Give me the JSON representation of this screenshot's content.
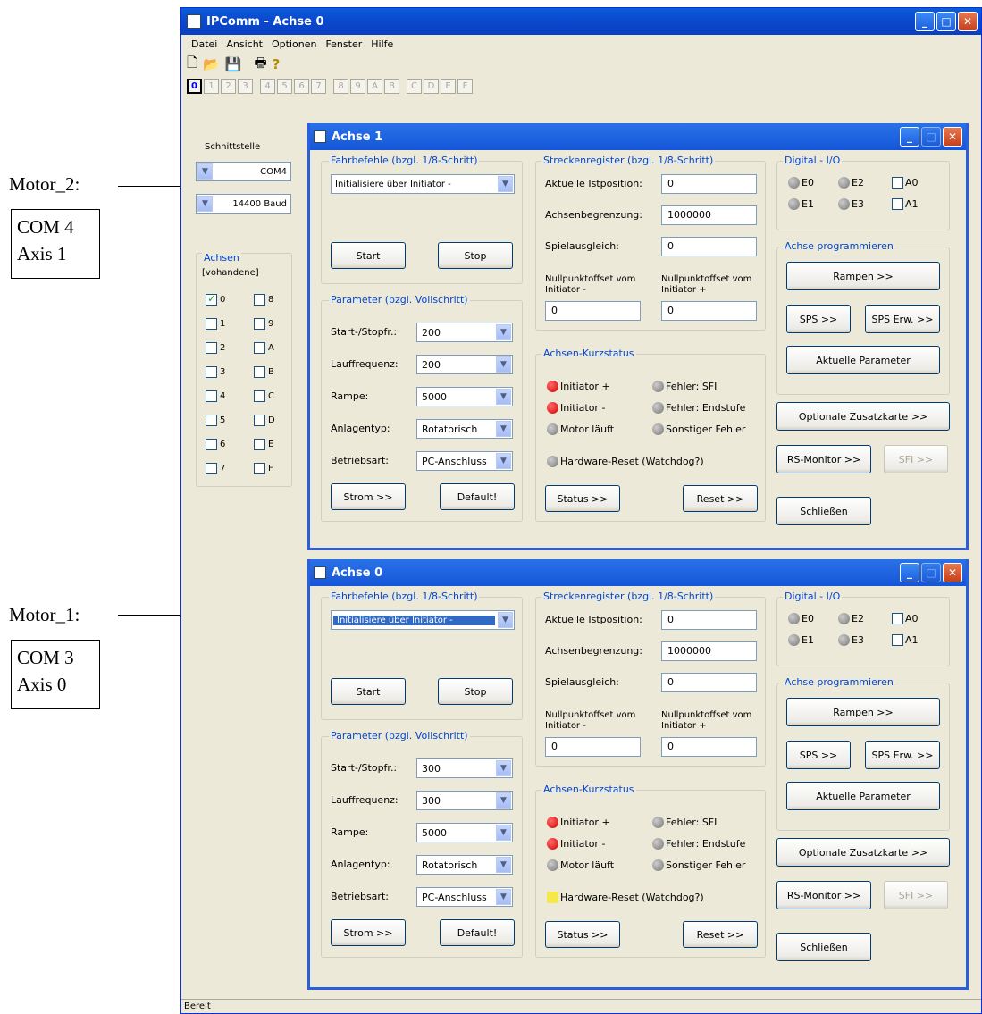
{
  "annotations": [
    {
      "label": "Motor_2:",
      "box": [
        "COM 4",
        "Axis 1"
      ]
    },
    {
      "label": "Motor_1:",
      "box": [
        "COM 3",
        "Axis 0"
      ]
    }
  ],
  "window": {
    "title": "IPComm - Achse 0"
  },
  "menu": [
    "Datei",
    "Ansicht",
    "Optionen",
    "Fenster",
    "Hilfe"
  ],
  "toolbar_icons": [
    "new-icon",
    "open-icon",
    "save-icon",
    "print-icon",
    "help-icon"
  ],
  "axis_tabs": [
    "0",
    "1",
    "2",
    "3",
    "4",
    "5",
    "6",
    "7",
    "8",
    "9",
    "A",
    "B",
    "C",
    "D",
    "E",
    "F"
  ],
  "left": {
    "interface_label": "Schnittstelle",
    "port": "COM4",
    "baud": "14400 Baud",
    "axes_label": "Achsen",
    "axes_sub": "[vohandene]",
    "axes": [
      {
        "l": "0",
        "c": true
      },
      {
        "l": "8",
        "c": false
      },
      {
        "l": "1",
        "c": false
      },
      {
        "l": "9",
        "c": false
      },
      {
        "l": "2",
        "c": false
      },
      {
        "l": "A",
        "c": false
      },
      {
        "l": "3",
        "c": false
      },
      {
        "l": "B",
        "c": false
      },
      {
        "l": "4",
        "c": false
      },
      {
        "l": "C",
        "c": false
      },
      {
        "l": "5",
        "c": false
      },
      {
        "l": "D",
        "c": false
      },
      {
        "l": "6",
        "c": false
      },
      {
        "l": "E",
        "c": false
      },
      {
        "l": "7",
        "c": false
      },
      {
        "l": "F",
        "c": false
      }
    ]
  },
  "child_windows": [
    {
      "title": "Achse 1",
      "drive_group": "Fahrbefehle (bzgl. 1/8-Schritt)",
      "drive_select": "Initialisiere über Initiator -",
      "start": "Start",
      "stop": "Stop",
      "param_group": "Parameter (bzgl. Vollschritt)",
      "params": [
        {
          "label": "Start-/Stopfr.:",
          "value": "200"
        },
        {
          "label": "Lauffrequenz:",
          "value": "200"
        },
        {
          "label": "Rampe:",
          "value": "5000"
        },
        {
          "label": "Anlagentyp:",
          "value": "Rotatorisch"
        },
        {
          "label": "Betriebsart:",
          "value": "PC-Anschluss"
        }
      ],
      "strom": "Strom >>",
      "default": "Default!",
      "reg_group": "Streckenregister (bzgl. 1/8-Schritt)",
      "regs": [
        {
          "label": "Aktuelle Istposition:",
          "value": "0"
        },
        {
          "label": "Achsenbegrenzung:",
          "value": "1000000"
        },
        {
          "label": "Spielausgleich:",
          "value": "0"
        }
      ],
      "offset_minus_label": "Nullpunktoffset vom Initiator -",
      "offset_plus_label": "Nullpunktoffset vom Initiator +",
      "offset_minus": "0",
      "offset_plus": "0",
      "status_group": "Achsen-Kurzstatus",
      "status_left": [
        {
          "label": "Initiator +",
          "color": "red"
        },
        {
          "label": "Initiator -",
          "color": "red"
        },
        {
          "label": "Motor läuft",
          "color": "grey"
        }
      ],
      "status_right": [
        {
          "label": "Fehler: SFI",
          "color": "grey"
        },
        {
          "label": "Fehler: Endstufe",
          "color": "grey"
        },
        {
          "label": "Sonstiger Fehler",
          "color": "grey"
        }
      ],
      "watchdog": {
        "label": "Hardware-Reset (Watchdog?)",
        "color": "grey"
      },
      "status_btn": "Status >>",
      "reset_btn": "Reset >>",
      "io_group": "Digital - I/O",
      "io": {
        "e0": "E0",
        "e1": "E1",
        "e2": "E2",
        "e3": "E3",
        "a0": "A0",
        "a1": "A1"
      },
      "prog_group": "Achse programmieren",
      "rampen": "Rampen >>",
      "sps": "SPS >>",
      "sps_erw": "SPS Erw. >>",
      "aktuelle": "Aktuelle Parameter",
      "optional": "Optionale Zusatzkarte >>",
      "rs_monitor": "RS-Monitor >>",
      "sfi": "SFI >>",
      "close": "Schließen"
    },
    {
      "title": "Achse 0",
      "drive_group": "Fahrbefehle (bzgl. 1/8-Schritt)",
      "drive_select": "Initialisiere über Initiator -",
      "start": "Start",
      "stop": "Stop",
      "param_group": "Parameter (bzgl. Vollschritt)",
      "params": [
        {
          "label": "Start-/Stopfr.:",
          "value": "300"
        },
        {
          "label": "Lauffrequenz:",
          "value": "300"
        },
        {
          "label": "Rampe:",
          "value": "5000"
        },
        {
          "label": "Anlagentyp:",
          "value": "Rotatorisch"
        },
        {
          "label": "Betriebsart:",
          "value": "PC-Anschluss"
        }
      ],
      "strom": "Strom >>",
      "default": "Default!",
      "reg_group": "Streckenregister (bzgl. 1/8-Schritt)",
      "regs": [
        {
          "label": "Aktuelle Istposition:",
          "value": "0"
        },
        {
          "label": "Achsenbegrenzung:",
          "value": "1000000"
        },
        {
          "label": "Spielausgleich:",
          "value": "0"
        }
      ],
      "offset_minus_label": "Nullpunktoffset vom Initiator -",
      "offset_plus_label": "Nullpunktoffset vom Initiator +",
      "offset_minus": "0",
      "offset_plus": "0",
      "status_group": "Achsen-Kurzstatus",
      "status_left": [
        {
          "label": "Initiator +",
          "color": "red"
        },
        {
          "label": "Initiator -",
          "color": "red"
        },
        {
          "label": "Motor läuft",
          "color": "grey"
        }
      ],
      "status_right": [
        {
          "label": "Fehler: SFI",
          "color": "grey"
        },
        {
          "label": "Fehler: Endstufe",
          "color": "grey"
        },
        {
          "label": "Sonstiger Fehler",
          "color": "grey"
        }
      ],
      "watchdog": {
        "label": "Hardware-Reset (Watchdog?)",
        "color": "yellow"
      },
      "status_btn": "Status >>",
      "reset_btn": "Reset >>",
      "io_group": "Digital - I/O",
      "io": {
        "e0": "E0",
        "e1": "E1",
        "e2": "E2",
        "e3": "E3",
        "a0": "A0",
        "a1": "A1"
      },
      "prog_group": "Achse programmieren",
      "rampen": "Rampen >>",
      "sps": "SPS >>",
      "sps_erw": "SPS Erw. >>",
      "aktuelle": "Aktuelle Parameter",
      "optional": "Optionale Zusatzkarte >>",
      "rs_monitor": "RS-Monitor >>",
      "sfi": "SFI >>",
      "close": "Schließen"
    }
  ],
  "statusbar": "Bereit"
}
